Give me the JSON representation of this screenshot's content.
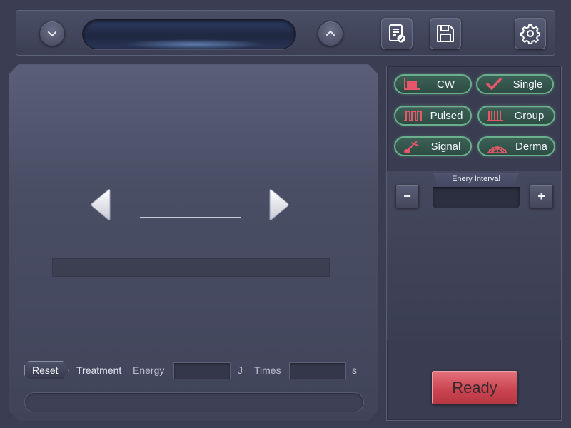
{
  "toolbar": {
    "display_text": "",
    "icons": [
      "chevron-down-icon",
      "chevron-up-icon",
      "document-check-icon",
      "save-icon",
      "gear-icon"
    ]
  },
  "main": {
    "value": "",
    "status_text": "",
    "reset_label": "Reset",
    "treatment_label": "Treatment",
    "energy_label": "Energy",
    "energy_value": "",
    "energy_unit": "J",
    "times_label": "Times",
    "times_value": "",
    "times_unit": "s",
    "bottom_text": ""
  },
  "modes": {
    "cw": "CW",
    "single": "Single",
    "pulsed": "Pulsed",
    "group": "Group",
    "signal": "Signal",
    "derma": "Derma"
  },
  "interval": {
    "label": "Enery Interval",
    "value": "",
    "minus": "−",
    "plus": "+"
  },
  "ready_label": "Ready",
  "colors": {
    "background": "#3b3e52",
    "mode_border": "#6ab08c",
    "icon_accent": "#e8566a",
    "ready": "#c9434f"
  }
}
